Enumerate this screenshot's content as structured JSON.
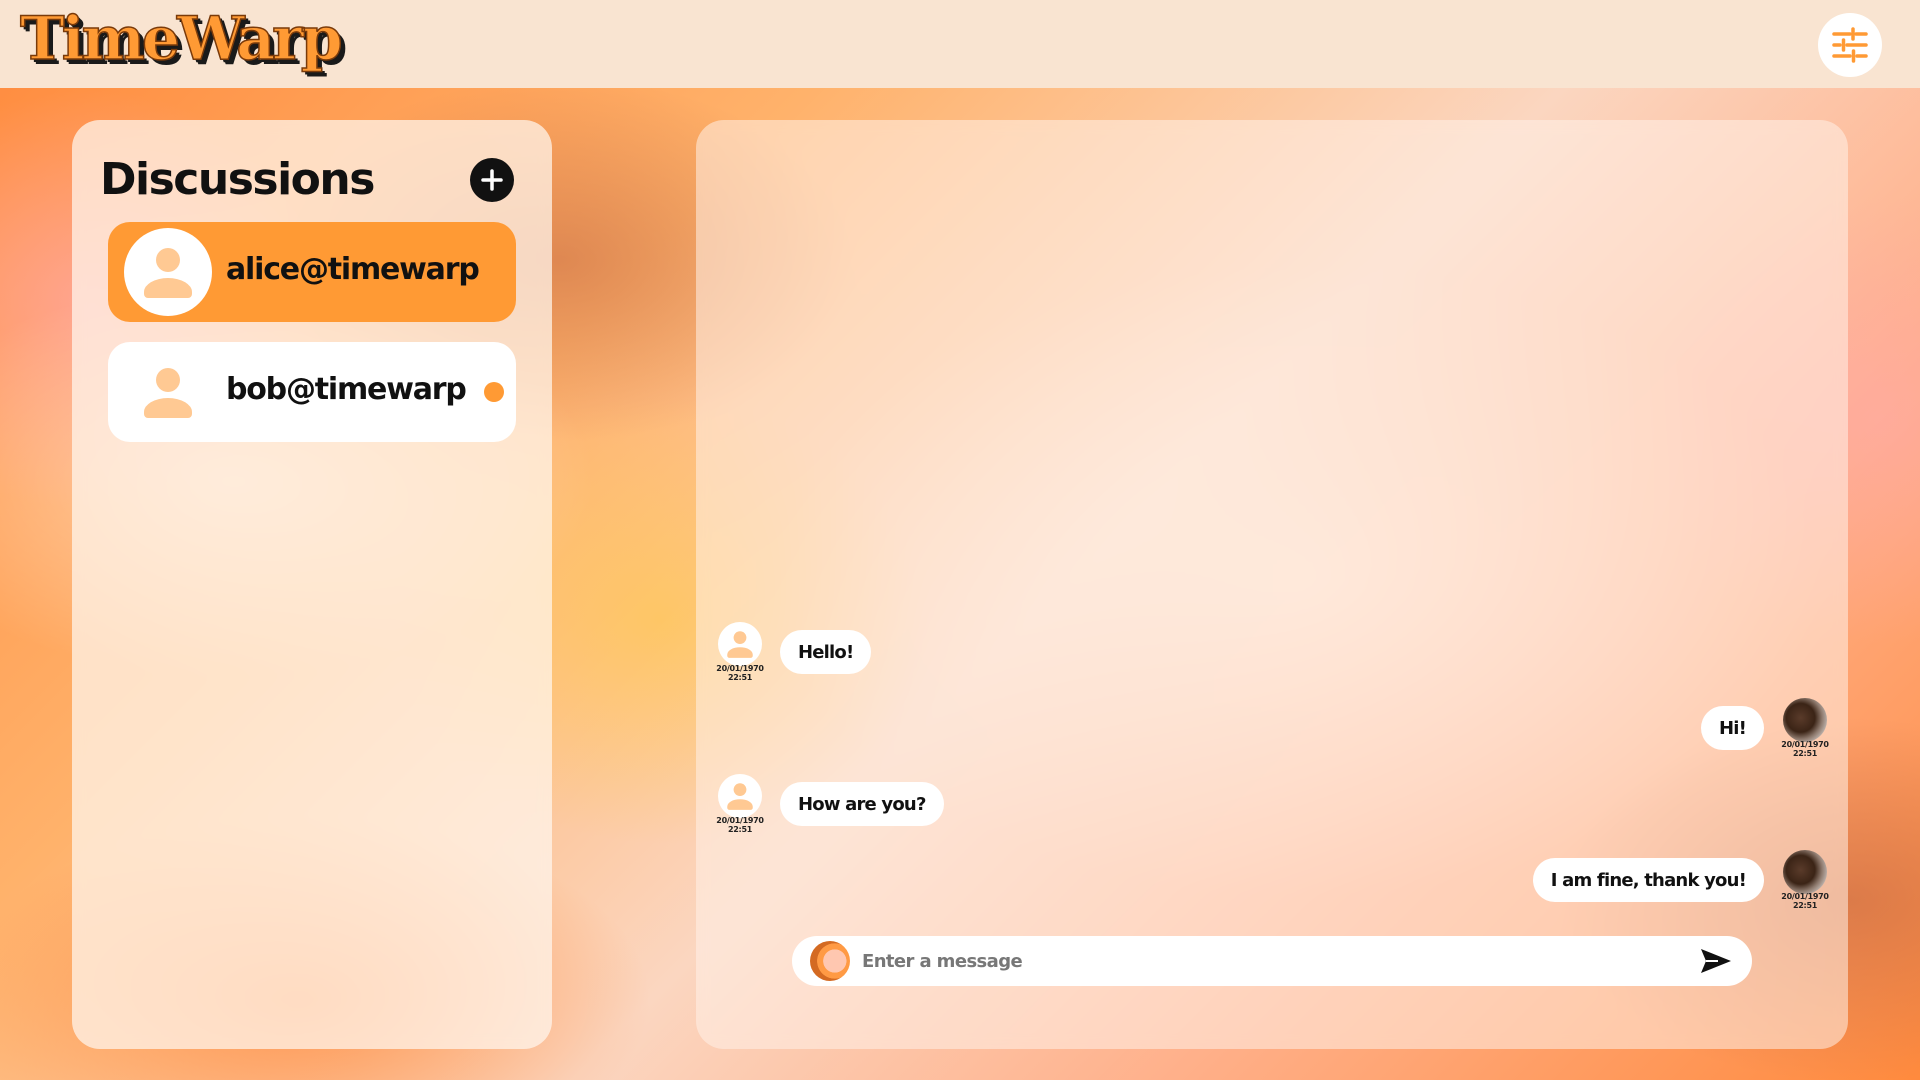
{
  "app": {
    "title": "TimeWarp",
    "accent_color": "#ff9a34"
  },
  "header": {
    "settings_icon": "sliders-icon"
  },
  "sidebar": {
    "title": "Discussions",
    "add_icon": "plus-circle-icon",
    "contacts": [
      {
        "name": "alice@timewarp",
        "active": true,
        "unread": false,
        "avatar_icon": "user-icon"
      },
      {
        "name": "bob@timewarp",
        "active": false,
        "unread": true,
        "avatar_icon": "user-icon"
      }
    ]
  },
  "chat": {
    "messages": [
      {
        "text": "Hello!",
        "side": "left",
        "time_date": "20/01/1970",
        "time_clock": "22:51",
        "avatar": "user-icon"
      },
      {
        "text": "Hi!",
        "side": "right",
        "time_date": "20/01/1970",
        "time_clock": "22:51",
        "avatar": "cat-photo"
      },
      {
        "text": "How are you?",
        "side": "left",
        "time_date": "20/01/1970",
        "time_clock": "22:51",
        "avatar": "user-icon"
      },
      {
        "text": "I am fine, thank you!",
        "side": "right",
        "time_date": "20/01/1970",
        "time_clock": "22:51",
        "avatar": "cat-photo"
      }
    ],
    "composer": {
      "placeholder": "Enter a message",
      "value": "",
      "attach_icon": "swirl-icon",
      "send_icon": "send-arrow-icon"
    }
  }
}
